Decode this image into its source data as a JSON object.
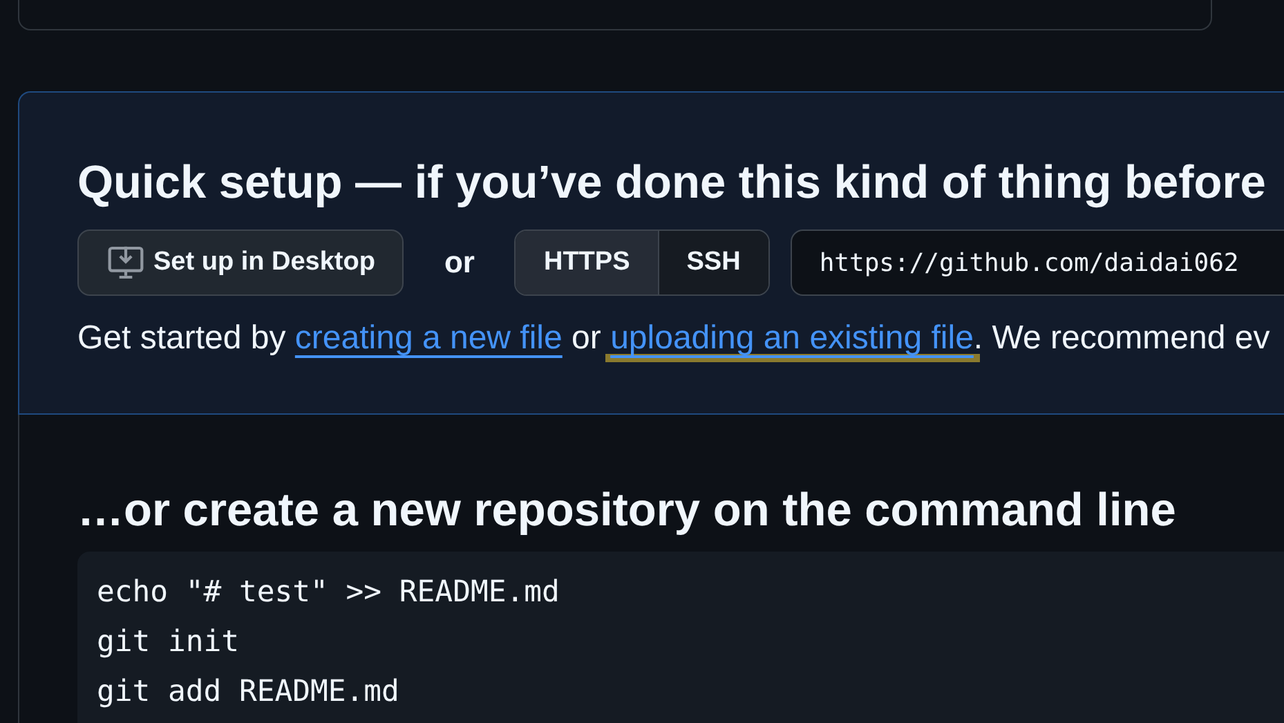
{
  "quick_setup": {
    "title": "Quick setup — if you’ve done this kind of thing before",
    "desktop_button": "Set up in Desktop",
    "separator": "or",
    "protocols": [
      {
        "label": "HTTPS",
        "selected": true
      },
      {
        "label": "SSH",
        "selected": false
      }
    ],
    "clone_url": "https://github.com/daidai062",
    "intro": [
      {
        "kind": "text",
        "text": "Get started by"
      },
      {
        "kind": "link",
        "text": "creating a new file",
        "highlighted": false
      },
      {
        "kind": "text",
        "text": "or"
      },
      {
        "kind": "link",
        "text": "uploading an existing file",
        "highlighted": true
      },
      {
        "kind": "text",
        "text": ". We recommend ev"
      }
    ]
  },
  "command_line": {
    "title": "…or create a new repository on the command line",
    "code": [
      "echo \"# test\" >> README.md",
      "git init",
      "git add README.md"
    ]
  }
}
